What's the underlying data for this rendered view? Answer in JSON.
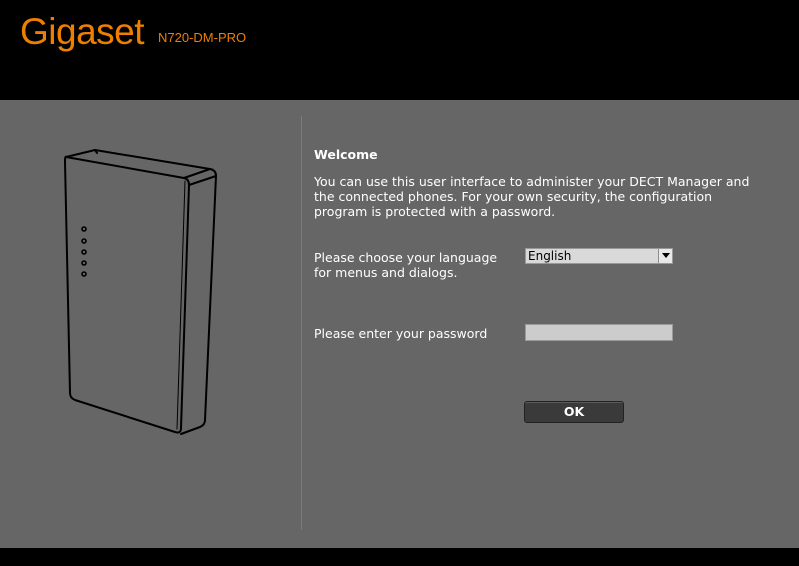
{
  "header": {
    "brand": "Gigaset",
    "model": "N720-DM-PRO"
  },
  "welcome": {
    "title": "Welcome",
    "text": "You can use this user interface to administer your DECT Manager and the connected phones. For your own security, the configuration program is protected with a password."
  },
  "language": {
    "label_line1": "Please choose your language",
    "label_line2": "for menus and dialogs.",
    "selected": "English"
  },
  "password": {
    "label": "Please enter your password",
    "value": ""
  },
  "ok_button": {
    "label": "OK"
  },
  "colors": {
    "brand_orange": "#ee7f00",
    "panel_gray": "#666666",
    "header_black": "#000000"
  }
}
